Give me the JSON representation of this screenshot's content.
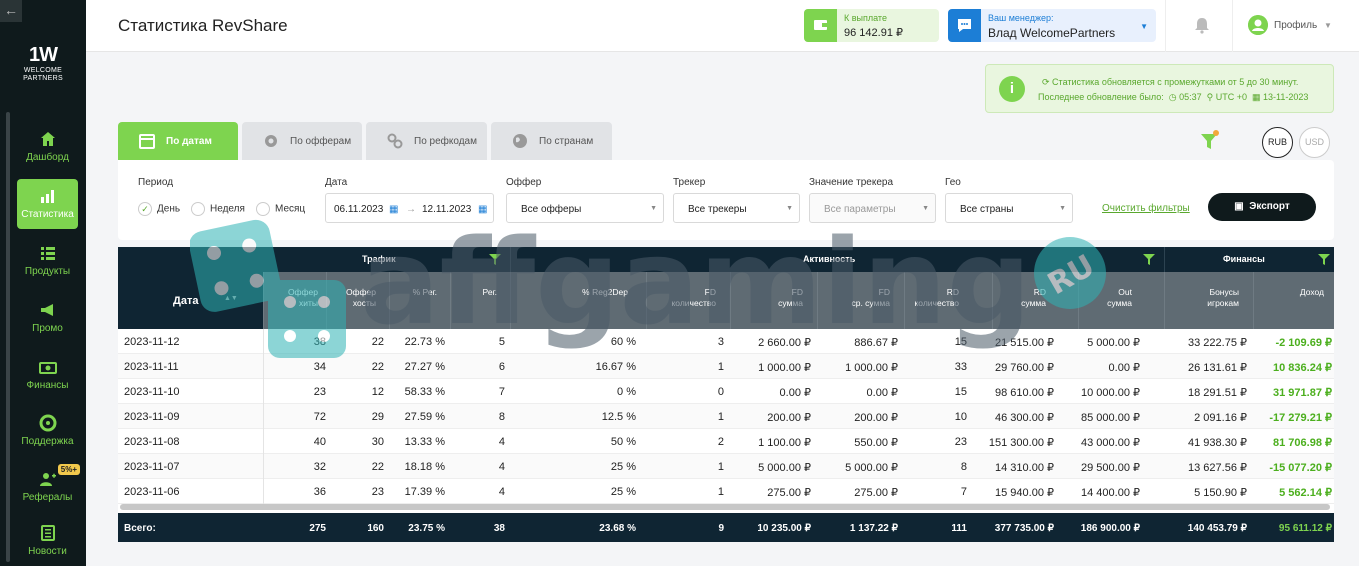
{
  "sidebar": {
    "logo_mark": "1W",
    "logo_text": "WELCOME PARTNERS",
    "items": [
      {
        "label": "Дашборд",
        "icon": "home-icon"
      },
      {
        "label": "Статистика",
        "icon": "chart-icon"
      },
      {
        "label": "Продукты",
        "icon": "list-icon"
      },
      {
        "label": "Промо",
        "icon": "megaphone-icon"
      },
      {
        "label": "Финансы",
        "icon": "money-icon"
      },
      {
        "label": "Поддержка",
        "icon": "lifebuoy-icon"
      },
      {
        "label": "Рефералы",
        "icon": "add-user-icon",
        "badge": "5%+"
      },
      {
        "label": "Новости",
        "icon": "news-icon"
      }
    ]
  },
  "header": {
    "title": "Статистика RevShare",
    "payout_caption": "К выплате",
    "payout_value": "96 142.91 ₽",
    "manager_caption": "Ваш менеджер:",
    "manager_name": "Влад WelcomePartners",
    "profile_label": "Профиль"
  },
  "notice": {
    "line1": "Статистика обновляется с промежутками от 5 до 30 минут.",
    "last_update_label": "Последнее обновление было:",
    "time": "05:37",
    "tz": "UTC +0",
    "date": "13-11-2023"
  },
  "tabs": [
    {
      "label": "По датам",
      "icon": "calendar-icon"
    },
    {
      "label": "По офферам",
      "icon": "gear-icon"
    },
    {
      "label": "По рефкодам",
      "icon": "link-icon"
    },
    {
      "label": "По странам",
      "icon": "globe-icon"
    }
  ],
  "currencies": [
    "RUB",
    "USD"
  ],
  "filters": {
    "period_label": "Период",
    "period_options": [
      "День",
      "Неделя",
      "Месяц"
    ],
    "date_label": "Дата",
    "date_from": "06.11.2023",
    "date_to": "12.11.2023",
    "offer_label": "Оффер",
    "offer_value": "Все офферы",
    "tracker_label": "Трекер",
    "tracker_value": "Все трекеры",
    "tracker_value_label": "Значение трекера",
    "tracker_value_value": "Все параметры",
    "geo_label": "Гео",
    "geo_value": "Все страны",
    "clear_label": "Очистить фильтры",
    "export_label": "Экспорт"
  },
  "table": {
    "groups": [
      "Трафик",
      "Активность",
      "Финансы"
    ],
    "date_header": "Дата",
    "columns": [
      [
        "Оффер",
        "хиты"
      ],
      [
        "Оффер",
        "хосты"
      ],
      [
        "% Рег.",
        ""
      ],
      [
        "Рег.",
        ""
      ],
      [
        "% Reg2Dep",
        ""
      ],
      [
        "FD",
        "количество"
      ],
      [
        "FD",
        "сумма"
      ],
      [
        "FD",
        "ср. сумма"
      ],
      [
        "RD",
        "количество"
      ],
      [
        "RD",
        "сумма"
      ],
      [
        "Out",
        "сумма"
      ],
      [
        "Бонусы",
        "игрокам"
      ],
      [
        "Доход",
        ""
      ]
    ],
    "rows": [
      [
        "2023-11-12",
        "38",
        "22",
        "22.73 %",
        "5",
        "60 %",
        "3",
        "2 660.00 ₽",
        "886.67 ₽",
        "15",
        "21 515.00 ₽",
        "5 000.00 ₽",
        "33 222.75 ₽",
        "-2 109.69 ₽"
      ],
      [
        "2023-11-11",
        "34",
        "22",
        "27.27 %",
        "6",
        "16.67 %",
        "1",
        "1 000.00 ₽",
        "1 000.00 ₽",
        "33",
        "29 760.00 ₽",
        "0.00 ₽",
        "26 131.61 ₽",
        "10 836.24 ₽"
      ],
      [
        "2023-11-10",
        "23",
        "12",
        "58.33 %",
        "7",
        "0 %",
        "0",
        "0.00 ₽",
        "0.00 ₽",
        "15",
        "98 610.00 ₽",
        "10 000.00 ₽",
        "18 291.51 ₽",
        "31 971.87 ₽"
      ],
      [
        "2023-11-09",
        "72",
        "29",
        "27.59 %",
        "8",
        "12.5 %",
        "1",
        "200.00 ₽",
        "200.00 ₽",
        "10",
        "46 300.00 ₽",
        "85 000.00 ₽",
        "2 091.16 ₽",
        "-17 279.21 ₽"
      ],
      [
        "2023-11-08",
        "40",
        "30",
        "13.33 %",
        "4",
        "50 %",
        "2",
        "1 100.00 ₽",
        "550.00 ₽",
        "23",
        "151 300.00 ₽",
        "43 000.00 ₽",
        "41 938.30 ₽",
        "81 706.98 ₽"
      ],
      [
        "2023-11-07",
        "32",
        "22",
        "18.18 %",
        "4",
        "25 %",
        "1",
        "5 000.00 ₽",
        "5 000.00 ₽",
        "8",
        "14 310.00 ₽",
        "29 500.00 ₽",
        "13 627.56 ₽",
        "-15 077.20 ₽"
      ],
      [
        "2023-11-06",
        "36",
        "23",
        "17.39 %",
        "4",
        "25 %",
        "1",
        "275.00 ₽",
        "275.00 ₽",
        "7",
        "15 940.00 ₽",
        "14 400.00 ₽",
        "5 150.90 ₽",
        "5 562.14 ₽"
      ]
    ],
    "total": [
      "Всего:",
      "275",
      "160",
      "23.75 %",
      "38",
      "23.68 %",
      "9",
      "10 235.00 ₽",
      "1 137.22 ₽",
      "111",
      "377 735.00 ₽",
      "186 900.00 ₽",
      "140 453.79 ₽",
      "95 611.12 ₽"
    ]
  },
  "watermark": {
    "text": "affgaming",
    "badge": "RU"
  },
  "colors": {
    "accent": "#7ed44f",
    "dark": "#0f1a1c",
    "table_head": "#0f2533",
    "manager": "#1c7ed6"
  }
}
